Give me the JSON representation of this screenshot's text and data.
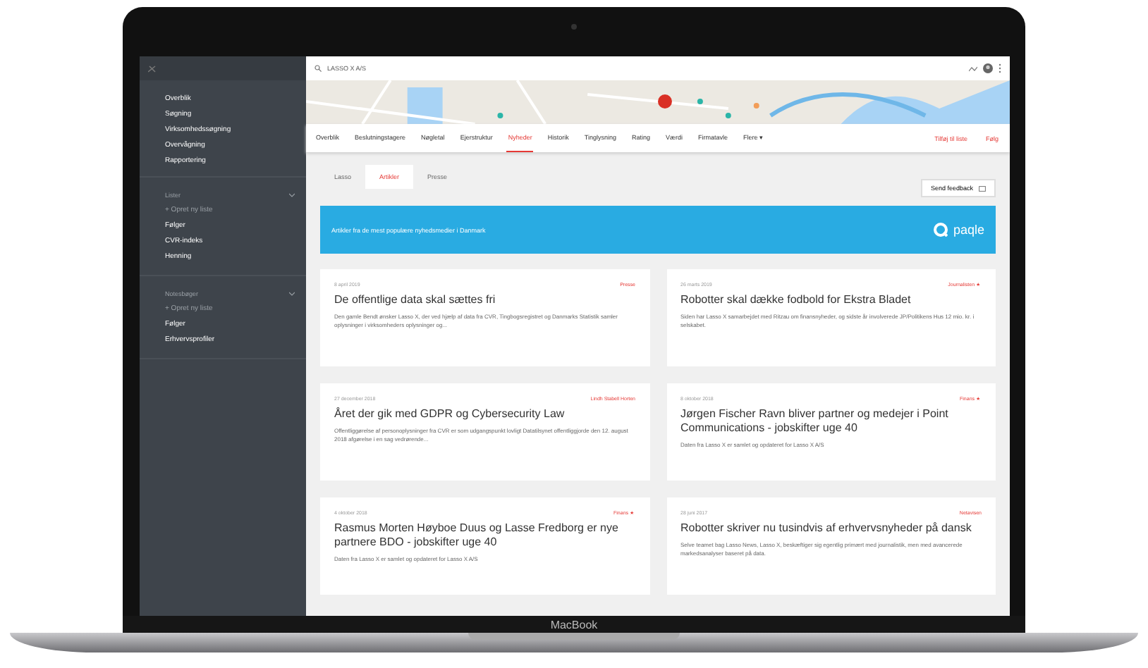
{
  "device": {
    "label": "MacBook"
  },
  "sidebar": {
    "items": [
      {
        "label": "Overblik"
      },
      {
        "label": "Søgning"
      },
      {
        "label": "Virksomhedssøgning"
      },
      {
        "label": "Overvågning"
      },
      {
        "label": "Rapportering"
      }
    ],
    "sections": [
      {
        "title": "Lister",
        "items": [
          {
            "label": "+ Opret ny liste",
            "kind": "action"
          },
          {
            "label": "Følger",
            "kind": "list"
          },
          {
            "label": "CVR-indeks",
            "kind": "list"
          },
          {
            "label": "Henning",
            "kind": "list"
          }
        ]
      },
      {
        "title": "Notesbøger",
        "items": [
          {
            "label": "+ Opret ny liste",
            "kind": "action"
          },
          {
            "label": "Følger",
            "kind": "list"
          },
          {
            "label": "Erhvervsprofiler",
            "kind": "list"
          }
        ]
      }
    ]
  },
  "search": {
    "value": "LASSO X A/S"
  },
  "tabs": [
    {
      "label": "Overblik",
      "selected": false
    },
    {
      "label": "Beslutningstagere",
      "selected": false
    },
    {
      "label": "Nøgletal",
      "selected": false
    },
    {
      "label": "Ejerstruktur",
      "selected": false
    },
    {
      "label": "Nyheder",
      "selected": true
    },
    {
      "label": "Historik",
      "selected": false
    },
    {
      "label": "Tinglysning",
      "selected": false
    },
    {
      "label": "Rating",
      "selected": false
    },
    {
      "label": "Værdi",
      "selected": false
    },
    {
      "label": "Firmatavle",
      "selected": false
    },
    {
      "label": "Flere ▾",
      "selected": false
    }
  ],
  "actions": [
    "Tilføj til liste",
    "Følg"
  ],
  "subtabs": [
    {
      "label": "Lasso",
      "selected": false
    },
    {
      "label": "Artikler",
      "selected": true
    },
    {
      "label": "Presse",
      "selected": false
    }
  ],
  "feedback_button": "Send feedback",
  "banner": {
    "text": "Artikler fra de mest populære nyhedsmedier i Danmark",
    "brand": "paqle"
  },
  "articles": [
    {
      "date": "8 april 2019",
      "source": "Presse",
      "title": "De offentlige data skal sættes fri",
      "summary": "Den gamle Bendt ønsker Lasso X, der ved hjælp af data fra CVR, Tingbogsregistret og Danmarks Statistik samler oplysninger i virksomheders oplysninger og..."
    },
    {
      "date": "26 marts 2019",
      "source": "Journalisten ★",
      "title": "Robotter skal dække fodbold for Ekstra Bladet",
      "summary": "Siden har Lasso X samarbejdet med Ritzau om finansnyheder, og sidste år involverede JP/Politikens Hus 12 mio. kr. i selskabet."
    },
    {
      "date": "27 december 2018",
      "source": "Lindh Stabell Horten",
      "title": "Året der gik med GDPR og Cybersecurity Law",
      "summary": "Offentliggørelse af personoplysninger fra CVR er som udgangspunkt lovligt Datatilsynet offentliggjorde den 12. august 2018 afgørelse i en sag vedrørende..."
    },
    {
      "date": "8 oktober 2018",
      "source": "Finans ★",
      "title": "Jørgen Fischer Ravn bliver partner og medejer i Point Communications - jobskifter uge 40",
      "summary": "Daten fra Lasso X er samlet og opdateret for Lasso X A/S"
    },
    {
      "date": "4 oktober 2018",
      "source": "Finans ★",
      "title": "Rasmus Morten Høyboe Duus og Lasse Fredborg er nye partnere BDO - jobskifter uge 40",
      "summary": "Daten fra Lasso X er samlet og opdateret for Lasso X A/S"
    },
    {
      "date": "28 juni 2017",
      "source": "Netavisen",
      "title": "Robotter skriver nu tusindvis af erhvervsnyheder på dansk",
      "summary": "Selve teamet bag Lasso News, Lasso X, beskæftiger sig egentlig primært med journalistik, men med avancerede markedsanalyser baseret på data."
    }
  ]
}
